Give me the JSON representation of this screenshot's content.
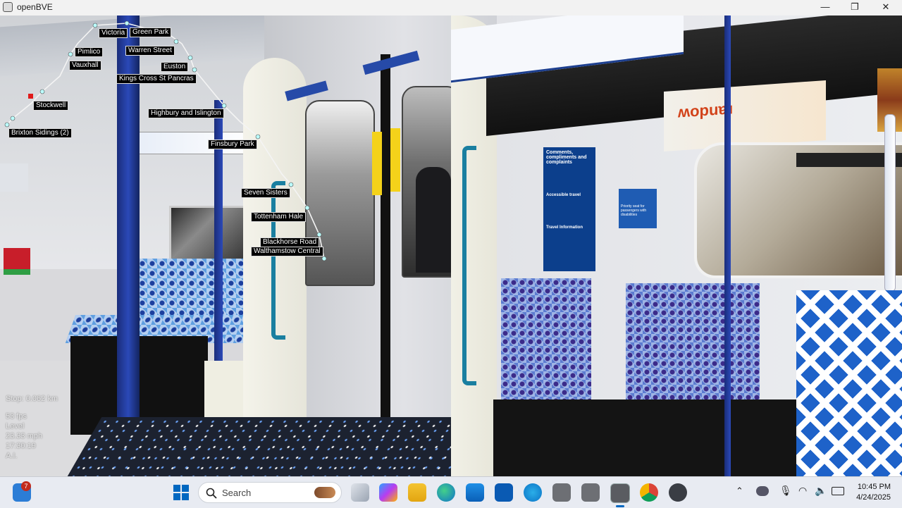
{
  "window": {
    "title": "openBVE",
    "minimize": "—",
    "maximize": "❐",
    "close": "✕"
  },
  "scene": {
    "ad_text": "ʍopuɐɹ",
    "notice_title": "Comments, compliments and complaints",
    "notice_sub": "Accessible travel",
    "notice_info": "Travel Information",
    "priority_sign": "Priority seat for passengers with disabilities"
  },
  "map": {
    "stations": [
      {
        "name": "Victoria"
      },
      {
        "name": "Green Park"
      },
      {
        "name": "Warren Street"
      },
      {
        "name": "Pimlico"
      },
      {
        "name": "Euston"
      },
      {
        "name": "Vauxhall"
      },
      {
        "name": "Kings Cross St Pancras"
      },
      {
        "name": "Stockwell"
      },
      {
        "name": "Highbury and Islington"
      },
      {
        "name": "Brixton Sidings (2)"
      },
      {
        "name": "Finsbury Park"
      },
      {
        "name": "Seven Sisters"
      },
      {
        "name": "Tottenham Hale"
      },
      {
        "name": "Blackhorse Road"
      },
      {
        "name": "Walthamstow Central"
      }
    ]
  },
  "hud": {
    "stop": "Stop: 0.062 km",
    "fps": "53 fps",
    "level": "Level",
    "speed": "23.33 mph",
    "time": "17:30:19",
    "mode": "A.I."
  },
  "taskbar": {
    "search_placeholder": "Search",
    "badge_count": "7",
    "time": "10:45 PM",
    "date": "4/24/2025",
    "colors": {
      "accent": "#0067c0",
      "badge": "#c42b1c"
    },
    "apps": [
      "widgets-icon",
      "start-icon",
      "search-icon",
      "task-view-icon",
      "copilot-icon",
      "file-explorer-icon",
      "edge-icon",
      "store-icon",
      "hp-icon",
      "weather-icon",
      "openbve-icon",
      "openbve-icon-2",
      "openbve-icon-3",
      "chrome-icon",
      "clock-app-icon"
    ]
  }
}
